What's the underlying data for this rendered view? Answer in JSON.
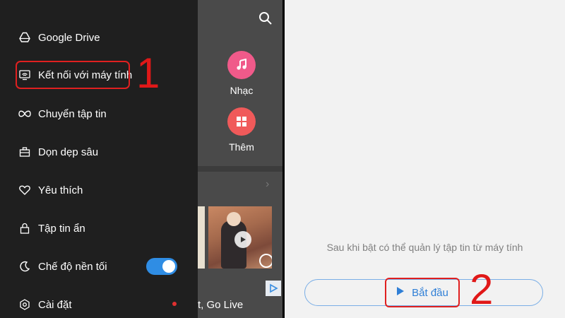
{
  "drawer": {
    "items": [
      {
        "label": "Google Drive",
        "icon": "google-drive-icon"
      },
      {
        "label": "Kết nối với máy tính",
        "icon": "wifi-computer-icon"
      },
      {
        "label": "Chuyển tập tin",
        "icon": "infinity-transfer-icon"
      },
      {
        "label": "Dọn dẹp sâu",
        "icon": "briefcase-clean-icon"
      },
      {
        "label": "Yêu thích",
        "icon": "heart-icon"
      },
      {
        "label": "Tập tin ẩn",
        "icon": "lock-icon"
      },
      {
        "label": "Chế độ nền tối",
        "icon": "moon-icon"
      },
      {
        "label": "Cài đặt",
        "icon": "gear-icon"
      }
    ],
    "dark_mode_on": true
  },
  "background": {
    "tiles": [
      {
        "label": "Nhạc",
        "icon": "music-note-icon",
        "color": "#f05a8a"
      },
      {
        "label": "Thêm",
        "icon": "grid-icon",
        "color": "#f05a5a"
      }
    ],
    "live_text": "t, Go Live"
  },
  "annotations": {
    "step1": "1",
    "step2": "2"
  },
  "right": {
    "hint": "Sau khi bật có thể quản lý tập tin từ máy tính",
    "start_label": "Bắt đầu"
  },
  "colors": {
    "drawer_bg": "#1f1f1f",
    "accent_blue": "#2f8de4",
    "annotation_red": "#e02020"
  }
}
